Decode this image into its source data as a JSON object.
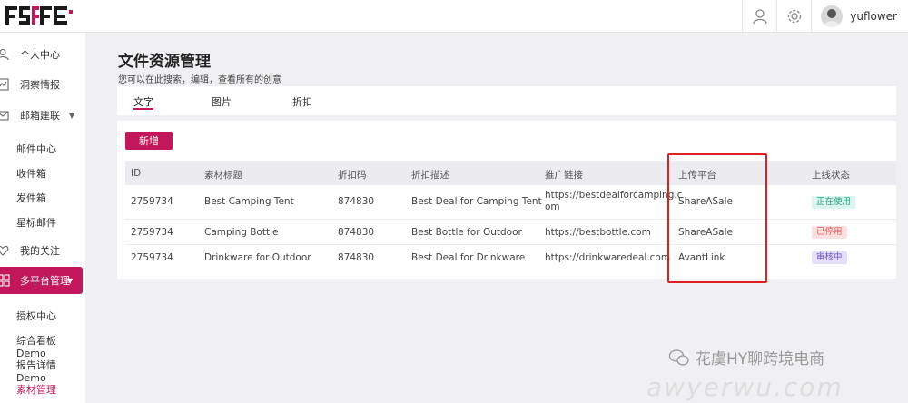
{
  "header": {
    "username": "yuflower"
  },
  "sidebar": {
    "items": [
      {
        "label": "个人中心"
      },
      {
        "label": "洞察情报"
      },
      {
        "label": "邮箱建联"
      },
      {
        "label": "我的关注"
      }
    ],
    "email_sub": [
      {
        "label": "邮件中心"
      },
      {
        "label": "收件箱"
      },
      {
        "label": "发件箱"
      },
      {
        "label": "星标邮件"
      }
    ],
    "active": {
      "label": "多平台管理"
    },
    "platform_sub": [
      {
        "label": "授权中心"
      },
      {
        "label": "综合看板Demo"
      },
      {
        "label": "报告详情Demo"
      },
      {
        "label": "素材管理"
      }
    ]
  },
  "main": {
    "title": "文件资源管理",
    "description": "您可以在此搜索，编辑，查看所有的创意",
    "tabs": [
      {
        "label": "文字"
      },
      {
        "label": "图片"
      },
      {
        "label": "折扣"
      }
    ],
    "new_button": "新增",
    "table": {
      "headers": [
        "ID",
        "素材标题",
        "折扣码",
        "折扣描述",
        "推广链接",
        "上传平台",
        "上线状态"
      ],
      "rows": [
        {
          "id": "2759734",
          "title": "Best Camping Tent",
          "code": "874830",
          "desc": "Best Deal for Camping Tent",
          "link_line1": "https://bestdealforcamping.c",
          "link_line2": "om",
          "platform": "ShareASale",
          "status": "正在使用"
        },
        {
          "id": "2759734",
          "title": "Camping Bottle",
          "code": "874830",
          "desc": "Best Bottle for Outdoor",
          "link_line1": "https://bestbottle.com",
          "link_line2": "",
          "platform": "ShareASale",
          "status": "已停用"
        },
        {
          "id": "2759734",
          "title": "Drinkware for Outdoor",
          "code": "874830",
          "desc": "Best Deal for Drinkware",
          "link_line1": "https://drinkwaredeal.com",
          "link_line2": "",
          "platform": "AvantLink",
          "status": "审核中"
        }
      ]
    }
  },
  "watermark": {
    "text": "花虞HY聊跨境电商",
    "url": "awyerwu.com"
  },
  "colors": {
    "brand": "#c2185b",
    "highlight": "#e02020"
  }
}
